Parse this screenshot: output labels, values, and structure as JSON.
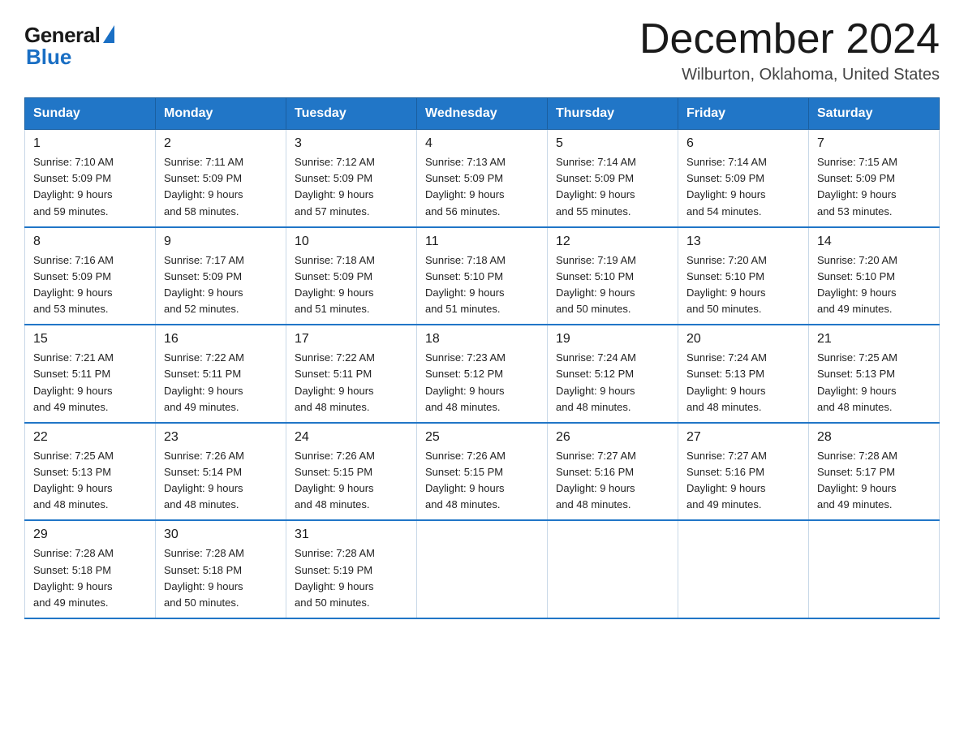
{
  "logo": {
    "general": "General",
    "blue": "Blue"
  },
  "title": "December 2024",
  "location": "Wilburton, Oklahoma, United States",
  "headers": [
    "Sunday",
    "Monday",
    "Tuesday",
    "Wednesday",
    "Thursday",
    "Friday",
    "Saturday"
  ],
  "weeks": [
    [
      {
        "day": "1",
        "sunrise": "7:10 AM",
        "sunset": "5:09 PM",
        "daylight": "9 hours and 59 minutes."
      },
      {
        "day": "2",
        "sunrise": "7:11 AM",
        "sunset": "5:09 PM",
        "daylight": "9 hours and 58 minutes."
      },
      {
        "day": "3",
        "sunrise": "7:12 AM",
        "sunset": "5:09 PM",
        "daylight": "9 hours and 57 minutes."
      },
      {
        "day": "4",
        "sunrise": "7:13 AM",
        "sunset": "5:09 PM",
        "daylight": "9 hours and 56 minutes."
      },
      {
        "day": "5",
        "sunrise": "7:14 AM",
        "sunset": "5:09 PM",
        "daylight": "9 hours and 55 minutes."
      },
      {
        "day": "6",
        "sunrise": "7:14 AM",
        "sunset": "5:09 PM",
        "daylight": "9 hours and 54 minutes."
      },
      {
        "day": "7",
        "sunrise": "7:15 AM",
        "sunset": "5:09 PM",
        "daylight": "9 hours and 53 minutes."
      }
    ],
    [
      {
        "day": "8",
        "sunrise": "7:16 AM",
        "sunset": "5:09 PM",
        "daylight": "9 hours and 53 minutes."
      },
      {
        "day": "9",
        "sunrise": "7:17 AM",
        "sunset": "5:09 PM",
        "daylight": "9 hours and 52 minutes."
      },
      {
        "day": "10",
        "sunrise": "7:18 AM",
        "sunset": "5:09 PM",
        "daylight": "9 hours and 51 minutes."
      },
      {
        "day": "11",
        "sunrise": "7:18 AM",
        "sunset": "5:10 PM",
        "daylight": "9 hours and 51 minutes."
      },
      {
        "day": "12",
        "sunrise": "7:19 AM",
        "sunset": "5:10 PM",
        "daylight": "9 hours and 50 minutes."
      },
      {
        "day": "13",
        "sunrise": "7:20 AM",
        "sunset": "5:10 PM",
        "daylight": "9 hours and 50 minutes."
      },
      {
        "day": "14",
        "sunrise": "7:20 AM",
        "sunset": "5:10 PM",
        "daylight": "9 hours and 49 minutes."
      }
    ],
    [
      {
        "day": "15",
        "sunrise": "7:21 AM",
        "sunset": "5:11 PM",
        "daylight": "9 hours and 49 minutes."
      },
      {
        "day": "16",
        "sunrise": "7:22 AM",
        "sunset": "5:11 PM",
        "daylight": "9 hours and 49 minutes."
      },
      {
        "day": "17",
        "sunrise": "7:22 AM",
        "sunset": "5:11 PM",
        "daylight": "9 hours and 48 minutes."
      },
      {
        "day": "18",
        "sunrise": "7:23 AM",
        "sunset": "5:12 PM",
        "daylight": "9 hours and 48 minutes."
      },
      {
        "day": "19",
        "sunrise": "7:24 AM",
        "sunset": "5:12 PM",
        "daylight": "9 hours and 48 minutes."
      },
      {
        "day": "20",
        "sunrise": "7:24 AM",
        "sunset": "5:13 PM",
        "daylight": "9 hours and 48 minutes."
      },
      {
        "day": "21",
        "sunrise": "7:25 AM",
        "sunset": "5:13 PM",
        "daylight": "9 hours and 48 minutes."
      }
    ],
    [
      {
        "day": "22",
        "sunrise": "7:25 AM",
        "sunset": "5:13 PM",
        "daylight": "9 hours and 48 minutes."
      },
      {
        "day": "23",
        "sunrise": "7:26 AM",
        "sunset": "5:14 PM",
        "daylight": "9 hours and 48 minutes."
      },
      {
        "day": "24",
        "sunrise": "7:26 AM",
        "sunset": "5:15 PM",
        "daylight": "9 hours and 48 minutes."
      },
      {
        "day": "25",
        "sunrise": "7:26 AM",
        "sunset": "5:15 PM",
        "daylight": "9 hours and 48 minutes."
      },
      {
        "day": "26",
        "sunrise": "7:27 AM",
        "sunset": "5:16 PM",
        "daylight": "9 hours and 48 minutes."
      },
      {
        "day": "27",
        "sunrise": "7:27 AM",
        "sunset": "5:16 PM",
        "daylight": "9 hours and 49 minutes."
      },
      {
        "day": "28",
        "sunrise": "7:28 AM",
        "sunset": "5:17 PM",
        "daylight": "9 hours and 49 minutes."
      }
    ],
    [
      {
        "day": "29",
        "sunrise": "7:28 AM",
        "sunset": "5:18 PM",
        "daylight": "9 hours and 49 minutes."
      },
      {
        "day": "30",
        "sunrise": "7:28 AM",
        "sunset": "5:18 PM",
        "daylight": "9 hours and 50 minutes."
      },
      {
        "day": "31",
        "sunrise": "7:28 AM",
        "sunset": "5:19 PM",
        "daylight": "9 hours and 50 minutes."
      },
      null,
      null,
      null,
      null
    ]
  ],
  "labels": {
    "sunrise": "Sunrise:",
    "sunset": "Sunset:",
    "daylight": "Daylight:"
  }
}
